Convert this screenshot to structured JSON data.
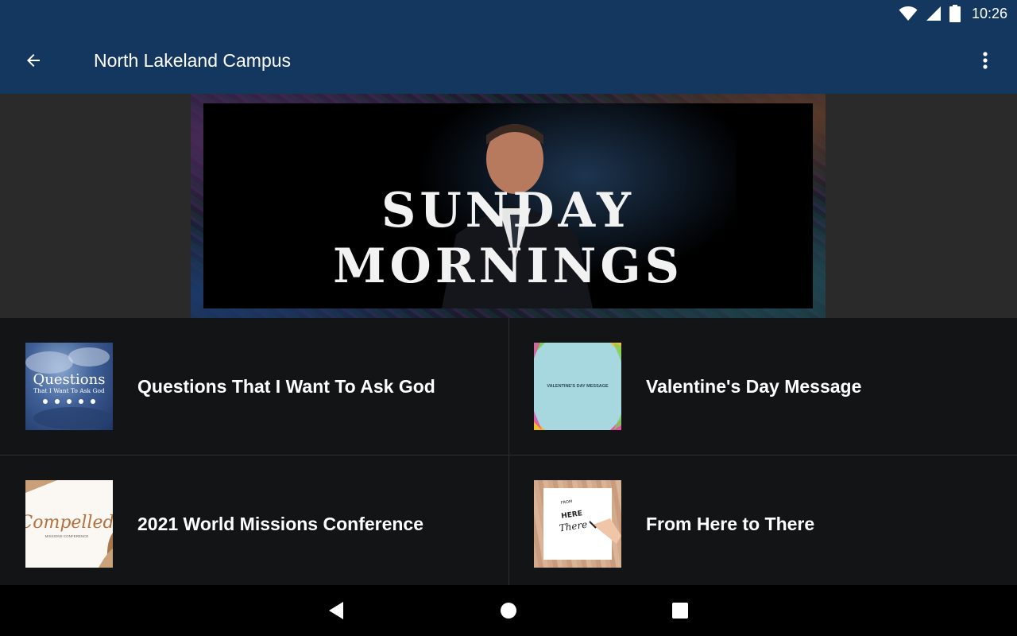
{
  "status_bar": {
    "time": "10:26",
    "icons": [
      "wifi-icon",
      "cell-signal-icon",
      "battery-icon"
    ]
  },
  "app_bar": {
    "title": "North Lakeland Campus",
    "back_icon": "arrow-back-icon",
    "menu_icon": "more-vert-icon"
  },
  "hero": {
    "banner_text": "SUNDAY MORNINGS"
  },
  "series": [
    {
      "title": "Questions That I Want To Ask God",
      "thumb_text": "Questions",
      "thumb_subtext": "That I Want To Ask God"
    },
    {
      "title": "Valentine's Day Message",
      "thumb_text": "VALENTINE'S DAY MESSAGE"
    },
    {
      "title": "2021 World Missions Conference",
      "thumb_text": "Compelled",
      "thumb_subtext": "MISSIONS CONFERENCE"
    },
    {
      "title": "From Here to There",
      "thumb_text": "FROM HERE TO There"
    }
  ],
  "nav_bar": {
    "icons": [
      "nav-back-icon",
      "nav-home-icon",
      "nav-recents-icon"
    ]
  },
  "colors": {
    "app_bar": "#143760",
    "background": "#131416",
    "hero_bg": "#2a2a2b"
  }
}
